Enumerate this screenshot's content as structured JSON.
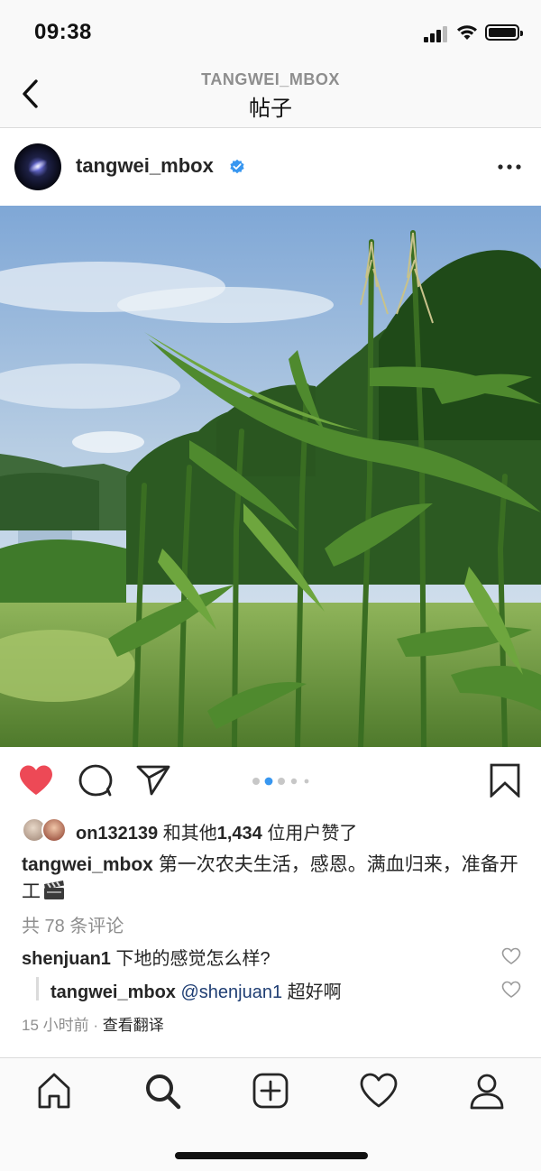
{
  "status_bar": {
    "time": "09:38"
  },
  "nav": {
    "subtitle": "TANGWEI_MBOX",
    "title": "帖子"
  },
  "post": {
    "username": "tangwei_mbox",
    "likes": {
      "liker": "on132139",
      "text": "和其他",
      "count": "1,434",
      "suffix": "位用户赞了"
    },
    "caption": {
      "username": "tangwei_mbox",
      "text": "第一次农夫生活，感恩。满血归来，准备开工"
    },
    "comments_count": "共 78 条评论",
    "comment": {
      "username": "shenjuan1",
      "text": "下地的感觉怎么样?"
    },
    "reply": {
      "username": "tangwei_mbox",
      "mention": "@shenjuan1",
      "text": "超好啊"
    },
    "time_ago": "15 小时前",
    "separator": " · ",
    "translate": "查看翻译",
    "carousel": {
      "total": 5,
      "active_index": 1
    },
    "liked": true
  },
  "icons": {
    "back": "chevron-left-icon",
    "verified": "verified-badge-icon",
    "more": "more-options-icon",
    "like": "heart-filled-icon",
    "comment": "comment-icon",
    "share": "send-icon",
    "save": "bookmark-icon",
    "comment_like": "heart-outline-icon",
    "emoji": "clapper-board-emoji",
    "tabs": [
      "home-icon",
      "search-icon",
      "add-post-icon",
      "activity-heart-icon",
      "profile-icon"
    ]
  },
  "colors": {
    "like_red": "#ed4956",
    "verified_blue": "#3897f0",
    "dot_active": "#3897f0",
    "dot_inactive": "#c7c7c7",
    "mention": "#1f3e73"
  }
}
